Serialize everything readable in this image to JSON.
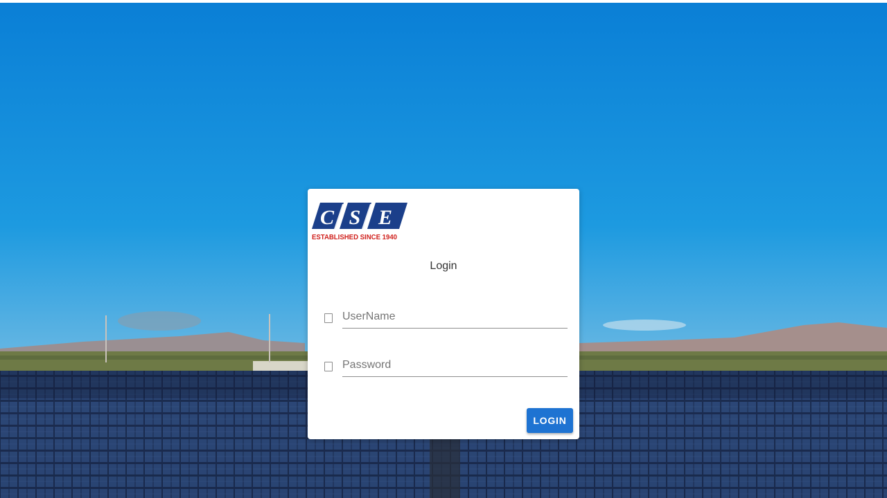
{
  "background": {
    "scene": "solar-panel-field",
    "sky_top": "#0a7fd6",
    "sky_bottom": "#8cc4e2",
    "panel_color": "#1c2f55"
  },
  "logo": {
    "letters": [
      "C",
      "S",
      "E"
    ],
    "tagline": "ESTABLISHED SINCE 1940",
    "brand_color": "#1b3f8a",
    "tagline_color": "#d0201c"
  },
  "login": {
    "title": "Login",
    "username": {
      "placeholder": "UserName",
      "value": "",
      "icon": "user-icon"
    },
    "password": {
      "placeholder": "Password",
      "value": "",
      "icon": "lock-icon"
    },
    "button_label": "LOGIN",
    "button_color": "#1e73d2"
  }
}
